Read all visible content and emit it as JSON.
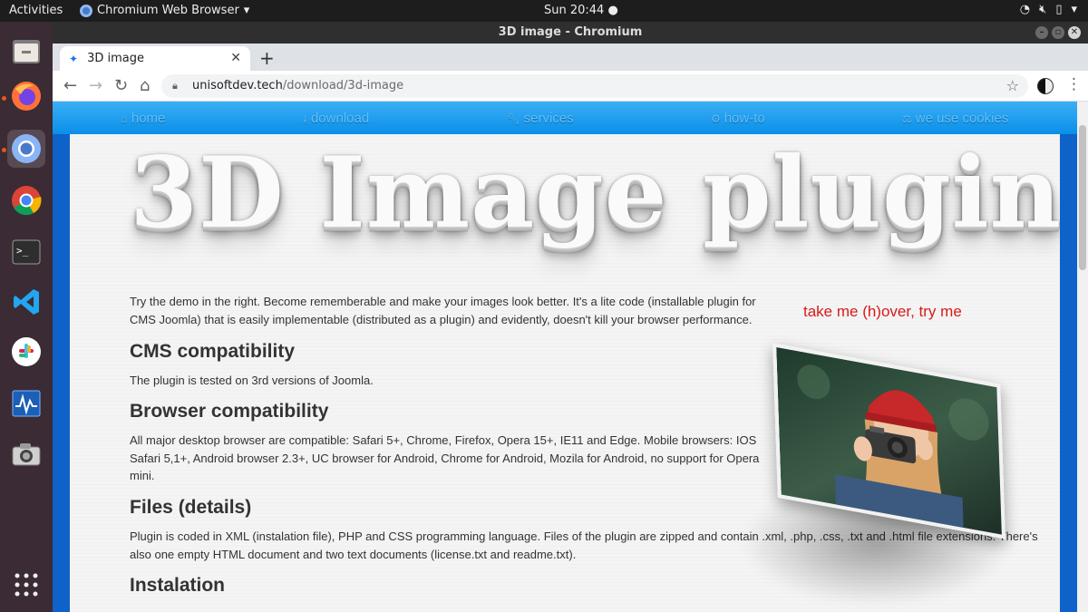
{
  "topbar": {
    "activities": "Activities",
    "app_name": "Chromium Web Browser",
    "clock": "Sun 20:44"
  },
  "dock": {
    "items": [
      "files-icon",
      "firefox-icon",
      "chromium-icon",
      "chrome-icon",
      "terminal-icon",
      "vscode-icon",
      "slack-icon",
      "system-monitor-icon",
      "screenshot-icon",
      "app-grid-icon"
    ]
  },
  "window": {
    "title": "3D image - Chromium"
  },
  "tab": {
    "title": "3D image"
  },
  "address": {
    "host": "unisoftdev.tech",
    "path": "/download/3d-image"
  },
  "site_nav": {
    "items": [
      {
        "icon": "home-icon",
        "label": "home"
      },
      {
        "icon": "download-icon",
        "label": "download"
      },
      {
        "icon": "wrench-icon",
        "label": "services"
      },
      {
        "icon": "gears-icon",
        "label": "how-to"
      },
      {
        "icon": "balance-icon",
        "label": "we use cookies"
      }
    ]
  },
  "page": {
    "hero_title": "3D Image plugin",
    "try_me": "take me (h)over, try me",
    "intro_line1": "Try the demo in the right. Become rememberable and make your images look better. It's a lite code (installable plugin for",
    "intro_line2": "CMS Joomla) that is easily implementable (distributed as a plugin) and evidently, doesn't kill your browser performance.",
    "cms_heading": "CMS compatibility",
    "cms_text": "The plugin is tested on 3rd versions of Joomla.",
    "browser_heading": "Browser compatibility",
    "browser_line1": "All major desktop browser are compatible: Safari 5+, Chrome, Firefox, Opera 15+, IE11 and Edge. Mobile browsers: IOS",
    "browser_line2": "Safari 5,1+, Android browser 2.3+, UC browser for Android, Chrome for Android, Mozila for Android, no support for Opera",
    "browser_line3": "mini.",
    "files_heading": "Files (details)",
    "files_line1": "Plugin is coded in XML (instalation file), PHP and CSS programming language. Files of the plugin are zipped and contain .xml, .php, .css, .txt and .html file extensions. There's",
    "files_line2": "also one empty HTML document and two text documents (license.txt and readme.txt).",
    "install_heading": "Instalation"
  }
}
